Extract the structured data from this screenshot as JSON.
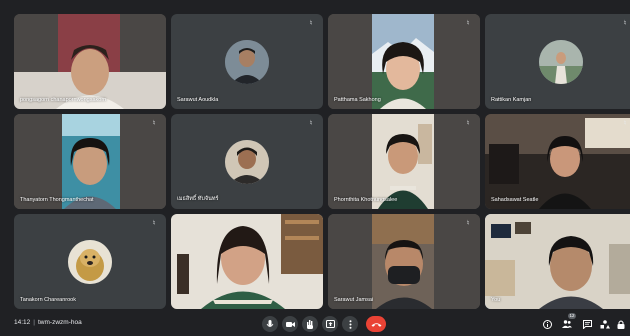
{
  "meeting": {
    "time": "14:12",
    "code": "twm-zwzm-hoa"
  },
  "participants": [
    {
      "name": "pongsagorn chanapornwongsakorn",
      "muted": false,
      "speaking": false
    },
    {
      "name": "Sarawut Aoudkla",
      "muted": true,
      "speaking": false
    },
    {
      "name": "Patthama Sakhong",
      "muted": true,
      "speaking": false
    },
    {
      "name": "Rattikan Kamjan",
      "muted": true,
      "speaking": false
    },
    {
      "name": "Thanyatorn Thongmanthechat",
      "muted": true,
      "speaking": false
    },
    {
      "name": "เมธสิทธิ์ ทับจันทร์",
      "muted": true,
      "speaking": false
    },
    {
      "name": "Phornthita Khotnungsalee",
      "muted": true,
      "speaking": false
    },
    {
      "name": "Sahadsawat Seatle",
      "muted": true,
      "speaking": false
    },
    {
      "name": "Tanakorn Chareanrook",
      "muted": true,
      "speaking": false
    },
    {
      "name": "",
      "muted": false,
      "speaking": false
    },
    {
      "name": "Sarawut Jamsai",
      "muted": true,
      "speaking": false
    },
    {
      "name": "You",
      "muted": false,
      "speaking": true
    }
  ],
  "controls": {
    "people_count": "12",
    "icons": [
      "mic-icon",
      "camera-icon",
      "raise-hand-icon",
      "present-icon",
      "more-icon",
      "end-call-icon"
    ],
    "side_icons": [
      "info-icon",
      "people-icon",
      "chat-icon",
      "activities-icon",
      "lock-icon"
    ]
  },
  "colors": {
    "background": "#202124",
    "tile": "#3c4043",
    "end_call": "#ea4335",
    "active_border": "#8ab4f8"
  }
}
